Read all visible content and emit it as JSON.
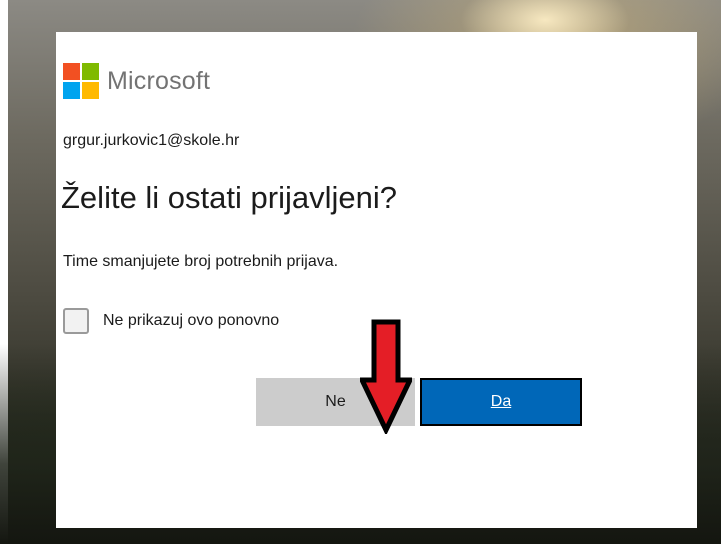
{
  "brand": {
    "name": "Microsoft",
    "colors": {
      "red": "#f25022",
      "green": "#7fba00",
      "blue": "#00a4ef",
      "yellow": "#ffb900"
    }
  },
  "account": {
    "email": "grgur.jurkovic1@skole.hr"
  },
  "prompt": {
    "title": "Želite li ostati prijavljeni?",
    "description": "Time smanjujete broj potrebnih prijava."
  },
  "checkbox": {
    "label": "Ne prikazuj ovo ponovno",
    "checked": false
  },
  "buttons": {
    "no_label": "Ne",
    "yes_label": "Da"
  },
  "annotation": {
    "icon": "red-down-arrow-icon",
    "color": "#e41e26"
  }
}
